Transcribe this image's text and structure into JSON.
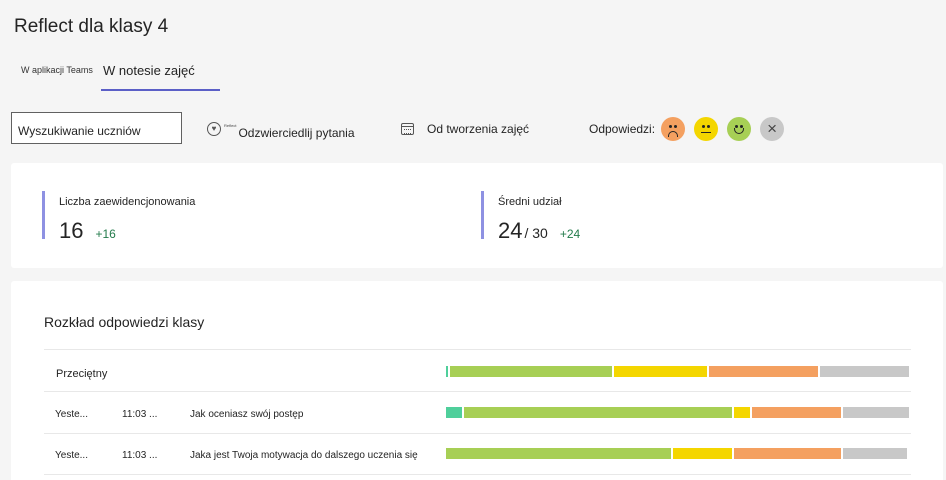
{
  "title": "Reflect dla klasy 4",
  "tabs": [
    {
      "label": "W aplikacji Teams"
    },
    {
      "label": "W notesie zajęć"
    }
  ],
  "search": {
    "placeholder": "Wyszukiwanie uczniów"
  },
  "filters": {
    "questions": {
      "tiny_text": "Reflect",
      "label": "Odzwierciedlij pytania"
    },
    "date": {
      "label": "Od tworzenia zajęć"
    }
  },
  "responses": {
    "label": "Odpowiedzi:",
    "options": [
      {
        "icon": "sad-face-icon",
        "color": "#f4a060"
      },
      {
        "icon": "neutral-face-icon",
        "color": "#f4d600"
      },
      {
        "icon": "happy-face-icon",
        "color": "#a7cf55"
      },
      {
        "icon": "close-icon",
        "glyph": "×",
        "color": "#c8c8c8"
      }
    ]
  },
  "stats": {
    "checkins": {
      "label": "Liczba zaewidencjonowania",
      "value": "16",
      "delta": "+16"
    },
    "participation": {
      "label": "Średni udział",
      "value": "24",
      "total": "/ 30",
      "delta": "+24"
    }
  },
  "distribution": {
    "title": "Rozkład odpowiedzi klasy",
    "colors": {
      "teal": "#4fcf9b",
      "green": "#a7cf55",
      "yellow": "#f4d600",
      "orange": "#f4a060",
      "gray": "#c8c8c8"
    },
    "rows": [
      {
        "label": "Przeciętny",
        "date": "",
        "time": "",
        "question": "",
        "segments": [
          0.005,
          0.355,
          0.205,
          0.24,
          0.195
        ]
      },
      {
        "label": "",
        "date": "Yeste...",
        "time": "11:03 ...",
        "question": "Jak oceniasz swój postęp",
        "segments": [
          0.035,
          0.59,
          0.035,
          0.195,
          0.145
        ]
      },
      {
        "label": "",
        "date": "Yeste...",
        "time": "11:03 ...",
        "question": "Jaka jest Twoja motywacja do dalszego uczenia się",
        "segments": [
          0.0,
          0.495,
          0.13,
          0.235,
          0.14
        ]
      }
    ]
  }
}
